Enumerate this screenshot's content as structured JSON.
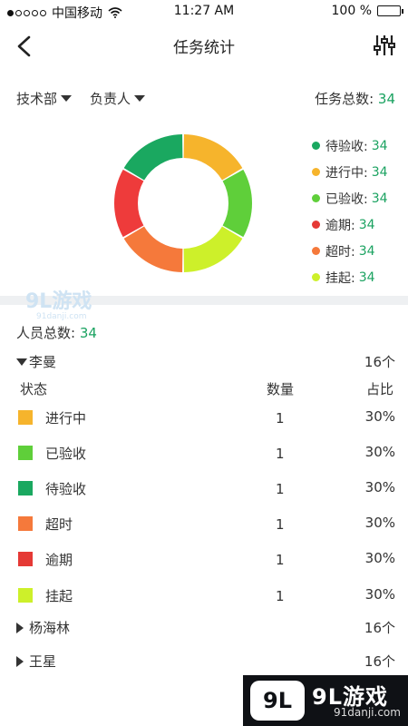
{
  "status_bar": {
    "carrier": "中国移动",
    "time": "11:27 AM",
    "battery": "100 %"
  },
  "nav": {
    "title": "任务统计",
    "back_icon": "chevron-left-icon",
    "filter_icon": "sliders-icon"
  },
  "filters": {
    "department": "技术部",
    "owner": "负责人"
  },
  "task_total": {
    "label": "任务总数:",
    "value": "34"
  },
  "donut": {
    "segments": [
      {
        "label": "进行中",
        "color": "#f6b42c",
        "fraction": 0.1667
      },
      {
        "label": "已验收",
        "color": "#5fcf3a",
        "fraction": 0.1667
      },
      {
        "label": "挂起",
        "color": "#cdf02a",
        "fraction": 0.1667
      },
      {
        "label": "超时",
        "color": "#f5793b",
        "fraction": 0.1667
      },
      {
        "label": "逾期",
        "color": "#ee3b3b",
        "fraction": 0.1667
      },
      {
        "label": "待验收",
        "color": "#1aa860",
        "fraction": 0.1667
      }
    ]
  },
  "legend": [
    {
      "label": "待验收:",
      "count": "34",
      "color": "#1aa860"
    },
    {
      "label": "进行中:",
      "count": "34",
      "color": "#f6b42c"
    },
    {
      "label": "已验收:",
      "count": "34",
      "color": "#5fcf3a"
    },
    {
      "label": "逾期:",
      "count": "34",
      "color": "#e53935"
    },
    {
      "label": "超时:",
      "count": "34",
      "color": "#f5793b"
    },
    {
      "label": "挂起:",
      "count": "34",
      "color": "#cdf02a"
    }
  ],
  "watermark": {
    "brand": "9L游戏",
    "site": "91danji.com"
  },
  "people_total": {
    "label": "人员总数:",
    "value": "34"
  },
  "persons": [
    {
      "name": "李曼",
      "count": "16个",
      "expanded": true
    },
    {
      "name": "杨海林",
      "count": "16个",
      "expanded": false
    },
    {
      "name": "王星",
      "count": "16个",
      "expanded": false
    }
  ],
  "table": {
    "headers": [
      "状态",
      "数量",
      "占比"
    ],
    "rows": [
      {
        "status": "进行中",
        "qty": "1",
        "pct": "30%",
        "color": "#f6b42c"
      },
      {
        "status": "已验收",
        "qty": "1",
        "pct": "30%",
        "color": "#5fcf3a"
      },
      {
        "status": "待验收",
        "qty": "1",
        "pct": "30%",
        "color": "#1aa860"
      },
      {
        "status": "超时",
        "qty": "1",
        "pct": "30%",
        "color": "#f5793b"
      },
      {
        "status": "逾期",
        "qty": "1",
        "pct": "30%",
        "color": "#e53935"
      },
      {
        "status": "挂起",
        "qty": "1",
        "pct": "30%",
        "color": "#cdf02a"
      }
    ]
  }
}
